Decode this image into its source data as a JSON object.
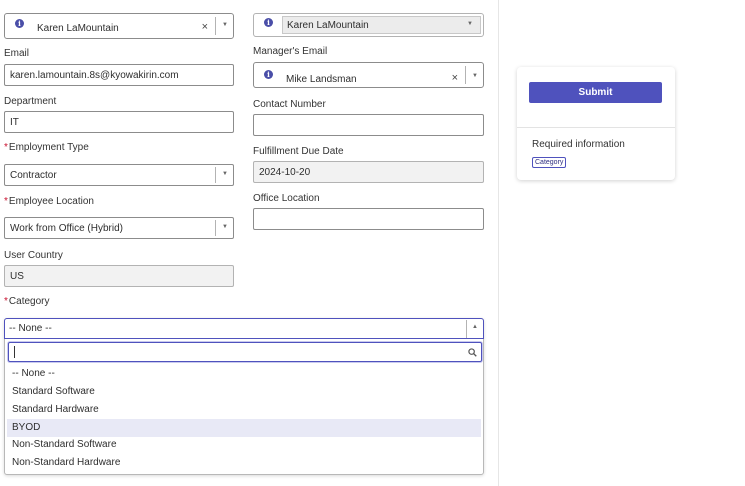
{
  "form": {
    "requested_for": {
      "value": "Karen LaMountain",
      "clear": "×"
    },
    "requested_by": {
      "value": "Karen LaMountain"
    },
    "email": {
      "label": "Email",
      "value": "karen.lamountain.8s@kyowakirin.com"
    },
    "managers_email": {
      "label": "Manager's Email",
      "value": "Mike Landsman",
      "clear": "×"
    },
    "department": {
      "label": "Department",
      "value": "IT"
    },
    "contact_number": {
      "label": "Contact Number",
      "value": ""
    },
    "employment_type": {
      "label": "Employment Type",
      "value": "Contractor",
      "required": true
    },
    "fulfillment_due_date": {
      "label": "Fulfillment Due Date",
      "value": "2024-10-20"
    },
    "employee_location": {
      "label": "Employee Location",
      "value": "Work from Office (Hybrid)",
      "required": true
    },
    "office_location": {
      "label": "Office Location",
      "value": ""
    },
    "user_country": {
      "label": "User Country",
      "value": "US"
    },
    "category": {
      "label": "Category",
      "required": true,
      "value": "-- None --",
      "search_value": "",
      "options": [
        "-- None --",
        "Standard Software",
        "Standard Hardware",
        "BYOD",
        "Non-Standard Software",
        "Non-Standard Hardware"
      ],
      "highlighted": "BYOD"
    }
  },
  "required_marker": "*",
  "sidebar": {
    "submit_label": "Submit",
    "required_info_label": "Required information",
    "required_badge": "Category"
  },
  "icons": {
    "info": "info-icon",
    "clear": "clear-icon",
    "caret": "caret-down-icon",
    "search": "search-icon"
  },
  "colors": {
    "accent": "#4f52bd",
    "required": "#c8102e",
    "highlight": "#e8e9f6"
  }
}
